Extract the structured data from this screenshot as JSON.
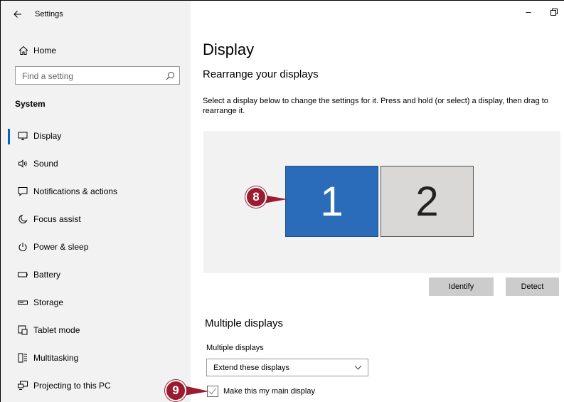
{
  "window": {
    "title": "Settings",
    "back_icon": "back-arrow-icon",
    "minimize_glyph": "–",
    "maximize_glyph": "🗗"
  },
  "sidebar": {
    "home_label": "Home",
    "search_placeholder": "Find a setting",
    "section_title": "System",
    "items": [
      {
        "label": "Display",
        "icon": "display-icon",
        "active": true
      },
      {
        "label": "Sound",
        "icon": "sound-icon",
        "active": false
      },
      {
        "label": "Notifications & actions",
        "icon": "notifications-icon",
        "active": false
      },
      {
        "label": "Focus assist",
        "icon": "focus-assist-icon",
        "active": false
      },
      {
        "label": "Power & sleep",
        "icon": "power-icon",
        "active": false
      },
      {
        "label": "Battery",
        "icon": "battery-icon",
        "active": false
      },
      {
        "label": "Storage",
        "icon": "storage-icon",
        "active": false
      },
      {
        "label": "Tablet mode",
        "icon": "tablet-mode-icon",
        "active": false
      },
      {
        "label": "Multitasking",
        "icon": "multitasking-icon",
        "active": false
      },
      {
        "label": "Projecting to this PC",
        "icon": "projecting-icon",
        "active": false
      }
    ]
  },
  "main": {
    "page_title": "Display",
    "rearrange_title": "Rearrange your displays",
    "rearrange_desc": "Select a display below to change the settings for it. Press and hold (or select) a display, then drag to rearrange it.",
    "monitors": [
      {
        "label": "1",
        "selected": true
      },
      {
        "label": "2",
        "selected": false
      }
    ],
    "identify_label": "Identify",
    "detect_label": "Detect",
    "multiple_displays_title": "Multiple displays",
    "multiple_displays_dropdown_label": "Multiple displays",
    "multiple_displays_value": "Extend these displays",
    "main_display_checkbox_label": "Make this my main display"
  },
  "callouts": [
    {
      "label": "8"
    },
    {
      "label": "9"
    }
  ],
  "colors": {
    "accent": "#0067c0",
    "selected_monitor": "#2b6cba",
    "callout": "#9b1b30"
  }
}
